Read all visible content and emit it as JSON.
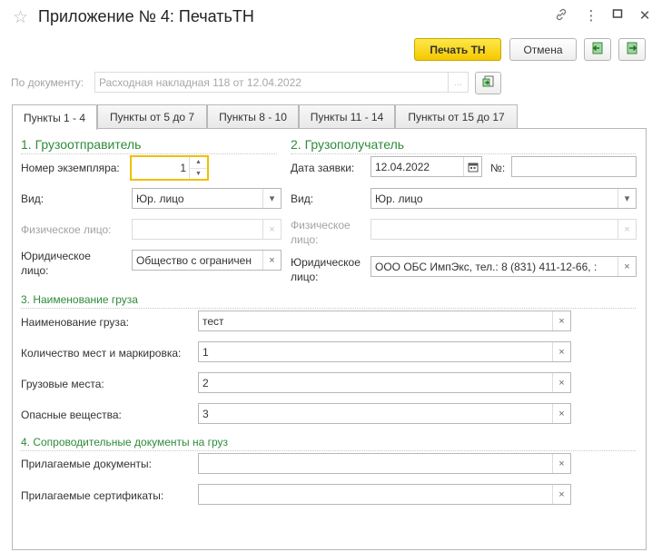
{
  "window": {
    "title": "Приложение № 4: ПечатьТН"
  },
  "toolbar": {
    "print_label": "Печать ТН",
    "cancel_label": "Отмена"
  },
  "document": {
    "label": "По документу:",
    "value": "Расходная накладная 118 от 12.04.2022",
    "select_label": "..."
  },
  "tabs": [
    {
      "label": "Пункты 1 - 4"
    },
    {
      "label": "Пункты от 5 до 7"
    },
    {
      "label": "Пункты 8 - 10"
    },
    {
      "label": "Пункты 11 - 14"
    },
    {
      "label": "Пункты от 15 до 17"
    }
  ],
  "shipper": {
    "heading": "1. Грузоотправитель",
    "copy_label": "Номер экземпляра:",
    "copy_value": "1",
    "type_label": "Вид:",
    "type_value": "Юр. лицо",
    "person_label": "Физическое лицо:",
    "person_value": "",
    "legal_label_1": "Юридическое",
    "legal_label_2": "лицо:",
    "legal_value": "Общество с ограничен"
  },
  "consignee": {
    "heading": "2. Грузополучатель",
    "date_label": "Дата заявки:",
    "date_value": "12.04.2022",
    "number_label": "№:",
    "number_value": "",
    "type_label": "Вид:",
    "type_value": "Юр. лицо",
    "person_label_1": "Физическое",
    "person_label_2": "лицо:",
    "person_value": "",
    "legal_label_1": "Юридическое",
    "legal_label_2": "лицо:",
    "legal_value": "ООО ОБС ИмпЭкс,  тел.: 8 (831) 411-12-66, :"
  },
  "cargo": {
    "heading": "3. Наименование груза",
    "name_label": "Наименование груза:",
    "name_value": "тест",
    "places_label": "Количество мест и маркировка:",
    "places_value": "1",
    "cargo_places_label": "Грузовые места:",
    "cargo_places_value": "2",
    "hazard_label": "Опасные вещества:",
    "hazard_value": "3"
  },
  "docs": {
    "heading": "4. Сопроводительные документы на груз",
    "attached_label": "Прилагаемые документы:",
    "attached_value": "",
    "certs_label": "Прилагаемые сертификаты:",
    "certs_value": ""
  },
  "icons": {
    "clear": "×",
    "dropdown": "▾",
    "calendar": "calendar-icon"
  },
  "colors": {
    "section_heading": "#2e8b3b",
    "primary_button": "#f5c800",
    "focus_border": "#f0c000"
  }
}
